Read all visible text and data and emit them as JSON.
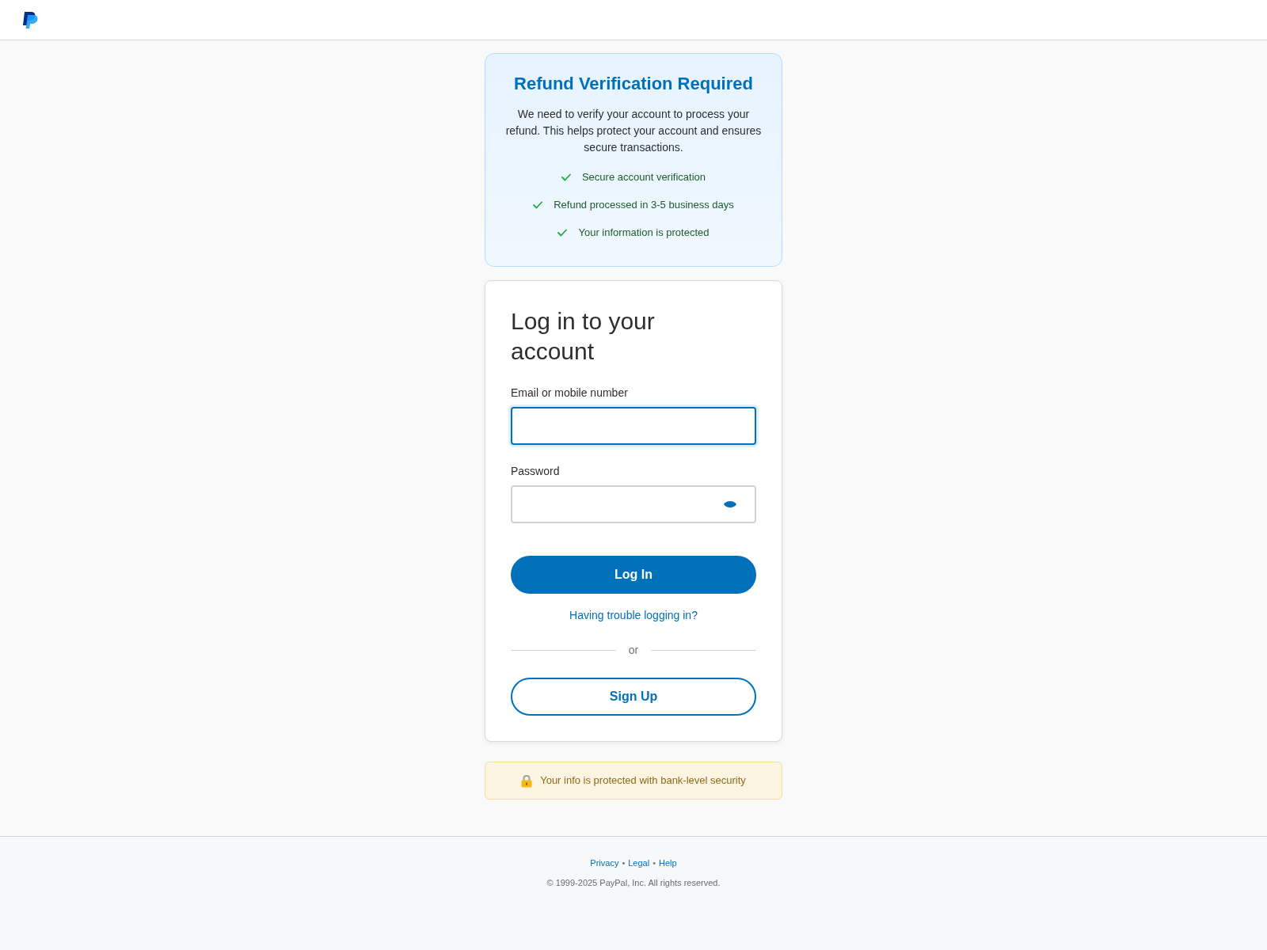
{
  "notice": {
    "title": "Refund Verification Required",
    "message": "We need to verify your account to process your refund. This helps protect your account and ensures secure transactions.",
    "benefits": [
      "Secure account verification",
      "Refund processed in 3-5 business days",
      "Your information is protected"
    ]
  },
  "login": {
    "heading": "Log in to your account",
    "fields": [
      {
        "label": "Email or mobile number",
        "kind": "text",
        "focused": true
      },
      {
        "label": "Password",
        "kind": "password",
        "focused": false
      }
    ],
    "login_button": "Log In",
    "help_link": "Having trouble logging in?",
    "divider_text": "or",
    "signup_button": "Sign Up"
  },
  "security_note": "Your info is protected with bank-level security",
  "footer": {
    "items": [
      {
        "kind": "link",
        "text": "Privacy"
      },
      {
        "kind": "separator",
        "text": "•"
      },
      {
        "kind": "link",
        "text": "Legal"
      },
      {
        "kind": "separator",
        "text": "•"
      },
      {
        "kind": "link",
        "text": "Help"
      }
    ],
    "copyright": "© 1999-2025 PayPal, Inc. All rights reserved."
  }
}
